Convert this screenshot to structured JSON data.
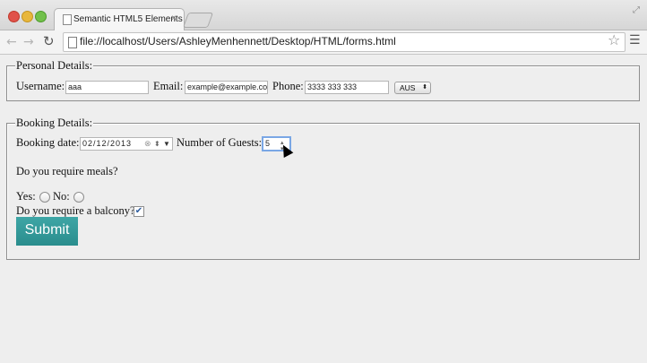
{
  "browser": {
    "tab_title": "Semantic HTML5 Elements",
    "tab_close": "×",
    "url": "file://localhost/Users/AshleyMenhennett/Desktop/HTML/forms.html"
  },
  "form": {
    "personal_legend": "Personal Details:",
    "username_label": "Username:",
    "username_value": "aaa",
    "email_label": "Email:",
    "email_value": "example@example.co",
    "phone_label": "Phone:",
    "phone_value": "3333 333 333",
    "country_selected": "AUS",
    "booking_legend": "Booking Details:",
    "booking_date_label": "Booking date:",
    "booking_date_value": "02/12/2013",
    "guests_label": "Number of Guests:",
    "guests_value": "5",
    "meals_question": "Do you require meals?",
    "yes_label": "Yes:",
    "no_label": "No:",
    "balcony_question": "Do you require a balcony?",
    "balcony_checked": true,
    "submit_label": "Submit"
  },
  "icons": {
    "back": "back-arrow-icon",
    "forward": "forward-arrow-icon",
    "reload": "reload-icon",
    "bookmark": "star-icon",
    "menu": "hamburger-menu-icon"
  }
}
